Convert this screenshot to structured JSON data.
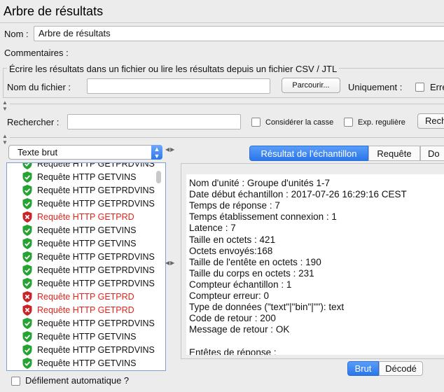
{
  "window": {
    "title": "Arbre de résultats"
  },
  "form": {
    "name_label": "Nom :",
    "name_value": "Arbre de résultats",
    "comments_label": "Commentaires :",
    "file_group_title": "Écrire les résultats dans un fichier ou lire les résultats depuis un fichier CSV / JTL",
    "filename_label": "Nom du fichier :",
    "filename_value": "",
    "browse_button": "Parcourir...",
    "only_label": "Uniquement :",
    "errors_partial": "Erre"
  },
  "search": {
    "label": "Rechercher :",
    "value": "",
    "case_label": "Considérer la casse",
    "regex_label": "Exp. regulière",
    "search_button_partial": "Rech"
  },
  "renderer": {
    "selected": "Texte brut"
  },
  "tree": {
    "items": [
      {
        "label": "Requête HTTP GETPRDVINS",
        "status": "ok"
      },
      {
        "label": "Requête HTTP GETVINS",
        "status": "ok"
      },
      {
        "label": "Requête HTTP GETPRDVINS",
        "status": "ok"
      },
      {
        "label": "Requête HTTP GETPRDVINS",
        "status": "ok"
      },
      {
        "label": "Requête HTTP GETPRD",
        "status": "error"
      },
      {
        "label": "Requête HTTP GETVINS",
        "status": "ok"
      },
      {
        "label": "Requête HTTP GETVINS",
        "status": "ok"
      },
      {
        "label": "Requête HTTP GETPRDVINS",
        "status": "ok"
      },
      {
        "label": "Requête HTTP GETPRDVINS",
        "status": "ok"
      },
      {
        "label": "Requête HTTP GETPRDVINS",
        "status": "ok"
      },
      {
        "label": "Requête HTTP GETPRD",
        "status": "error"
      },
      {
        "label": "Requête HTTP GETPRD",
        "status": "error"
      },
      {
        "label": "Requête HTTP GETPRDVINS",
        "status": "ok"
      },
      {
        "label": "Requête HTTP GETVINS",
        "status": "ok"
      },
      {
        "label": "Requête HTTP GETPRDVINS",
        "status": "ok"
      },
      {
        "label": "Requête HTTP GETVINS",
        "status": "ok"
      }
    ],
    "autoscroll_label": "Défilement automatique ?"
  },
  "tabs": [
    {
      "label": "Résultat de l'échantillon",
      "active": true
    },
    {
      "label": "Requête",
      "active": false
    },
    {
      "label": "Do",
      "active": false
    }
  ],
  "sample_result": {
    "lines": [
      "Nom d'unité : Groupe d'unités 1-7",
      "Date début échantillon : 2017-07-26 16:29:16 CEST",
      "Temps de réponse : 7",
      "Temps établissement connexion : 1",
      "Latence : 7",
      "Taille en octets : 421",
      "Octets envoyés:168",
      "Taille de l'entête en octets : 190",
      "Taille du corps en octets : 231",
      "Compteur échantillon : 1",
      "Compteur erreur: 0",
      "Type de données (\"text\"|\"bin\"|\"\"): text",
      "Code de retour : 200",
      "Message de retour : OK",
      "",
      "Entêtes de réponse :"
    ]
  },
  "view_toggle": {
    "raw": "Brut",
    "decoded": "Décodé",
    "active": "raw"
  },
  "colors": {
    "accent": "#2a76ea",
    "error": "#e0241b",
    "ok": "#1e9e2e"
  }
}
